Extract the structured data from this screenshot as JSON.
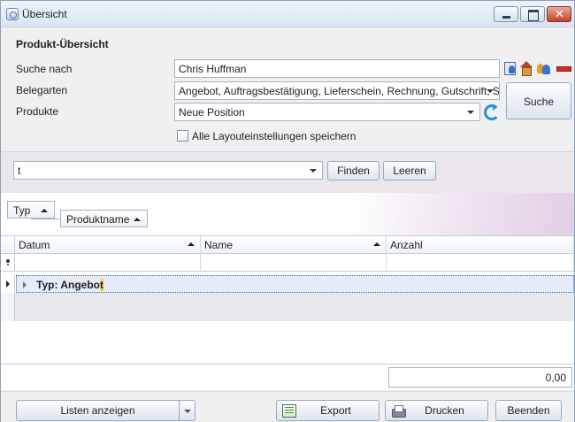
{
  "window": {
    "title": "Übersicht"
  },
  "form": {
    "section_title": "Produkt-Übersicht",
    "suche_nach_label": "Suche nach",
    "suche_nach_value": "Chris Huffman",
    "belegarten_label": "Belegarten",
    "belegarten_value": "Angebot, Auftragsbestätigung, Lieferschein, Rechnung, Gutschrift, S...",
    "produkte_label": "Produkte",
    "produkte_value": "Neue Position",
    "search_button": "Suche",
    "save_layout_checkbox_label": "Alle Layouteinstellungen speichern",
    "save_layout_checked": false
  },
  "filter": {
    "value": "t",
    "finden_button": "Finden",
    "leeren_button": "Leeren"
  },
  "grouping": {
    "chips": [
      "Typ",
      "Produktname"
    ]
  },
  "grid": {
    "columns": [
      "Datum",
      "Name",
      "Anzahl"
    ],
    "group_row_prefix": "Typ: Angebo",
    "group_row_highlight": "t",
    "total": "0,00"
  },
  "footer": {
    "listen_button": "Listen anzeigen",
    "export_button": "Export",
    "drucken_button": "Drucken",
    "beenden_button": "Beenden"
  },
  "icons": {
    "title": "app-icon",
    "side": [
      "contact-card-icon",
      "house-icon",
      "users-icon",
      "remove-icon"
    ],
    "refresh": "refresh-icon"
  }
}
